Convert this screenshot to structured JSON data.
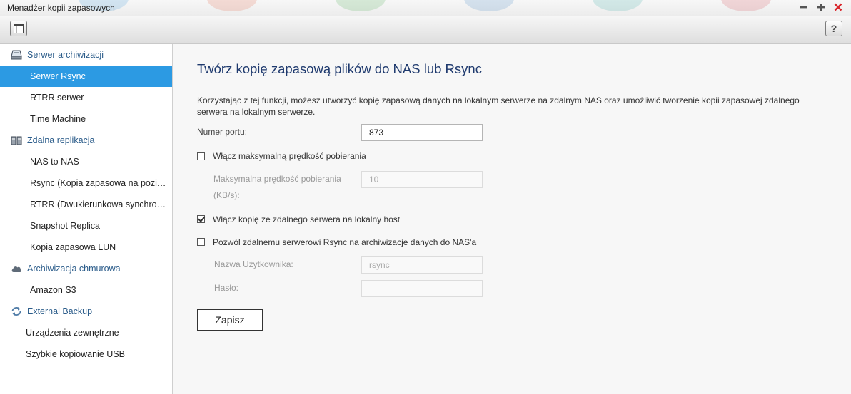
{
  "window": {
    "title": "Menadżer kopii zapasowych",
    "controls": [
      "minimize-icon",
      "maximize-icon",
      "close-icon"
    ],
    "close_color": "#d9262c"
  },
  "toolbar": {
    "help_label": "?"
  },
  "sidebar": {
    "accent": "#2c9ae3",
    "group_color": "#2b5c8a",
    "groups": [
      {
        "label": "Serwer archiwizacji",
        "icon": "server-icon",
        "items": [
          "Serwer Rsync",
          "RTRR serwer",
          "Time Machine"
        ]
      },
      {
        "label": "Zdalna replikacja",
        "icon": "replication-icon",
        "items": [
          "NAS to NAS",
          "Rsync (Kopia zapasowa na poziomie plików)",
          "RTRR (Dwukierunkowa synchronizacja)",
          "Snapshot Replica",
          "Kopia zapasowa LUN"
        ]
      },
      {
        "label": "Archiwizacja chmurowa",
        "icon": "cloud-icon",
        "items": [
          "Amazon S3"
        ]
      },
      {
        "label": "External Backup",
        "icon": "sync-arrows-icon",
        "items": [
          "Urządzenia zewnętrzne",
          "Szybkie kopiowanie USB"
        ]
      }
    ],
    "active_item": "Serwer Rsync"
  },
  "main": {
    "heading": "Twórz kopię zapasową plików do NAS lub Rsync",
    "description": "Korzystając z tej funkcji, możesz utworzyć kopię zapasową danych na lokalnym serwerze na zdalnym NAS oraz umożliwić tworzenie kopii zapasowej zdalnego serwera na lokalnym serwerze.",
    "port": {
      "label": "Numer portu:",
      "value": "873"
    },
    "max_speed_checkbox": {
      "label": "Włącz maksymalną prędkość pobierania",
      "checked": false
    },
    "max_speed": {
      "label_line1": "Maksymalna prędkość pobierania",
      "label_line2": "(KB/s):",
      "value": "10"
    },
    "remote_copy_checkbox": {
      "label": "Włącz kopię ze zdalnego serwera na lokalny host",
      "checked": true
    },
    "allow_remote_checkbox": {
      "label": "Pozwól zdalnemu serwerowi Rsync na archiwizacje danych do NAS'a",
      "checked": false
    },
    "username": {
      "label": "Nazwa Użytkownika:",
      "value": "rsync"
    },
    "password": {
      "label": "Hasło:",
      "value": ""
    },
    "save_label": "Zapisz"
  }
}
